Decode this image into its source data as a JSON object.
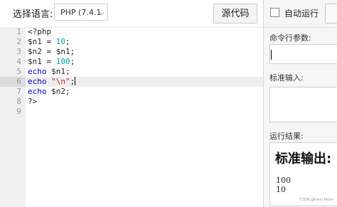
{
  "toolbar": {
    "language_label": "选择语言:",
    "language_value": "PHP (7.4.1",
    "source_button": "源代码"
  },
  "editor": {
    "line_numbers": [
      "1",
      "2",
      "3",
      "4",
      "5",
      "6",
      "7",
      "8",
      "9"
    ],
    "active_line": 6,
    "code": {
      "l1": "<?php",
      "l2_var": "$n1 = ",
      "l2_num": "10",
      "l2_end": ";",
      "l3": "$n2 = $n1;",
      "l4_var": "$n1 = ",
      "l4_num": "100",
      "l4_end": ";",
      "l5_kw": "echo",
      "l5_rest": " $n1;",
      "l6_kw": "echo",
      "l6_sp": " ",
      "l6_str": "\"\\n\"",
      "l6_end": ";",
      "l7_kw": "echo",
      "l7_rest": " $n2;",
      "l8": "?>",
      "l9": ""
    }
  },
  "right_panel": {
    "auto_run_label": "自动运行",
    "auto_run_checked": false,
    "args_label": "命令行参数:",
    "args_value": "",
    "stdin_label": "标准输入:",
    "stdin_value": "",
    "result_label": "运行结果:",
    "output_title": "标准输出:",
    "output_lines": [
      "100",
      "10"
    ],
    "watermark": "CSDN @Irwin Myon"
  },
  "icons": {
    "dropdown": "chevron-down-icon"
  },
  "colors": {
    "keyword": "#0000cc",
    "number": "#0a9a9a",
    "string": "#cc2222",
    "gutter": "#f0f0f0",
    "panel": "#f6f6f6"
  }
}
